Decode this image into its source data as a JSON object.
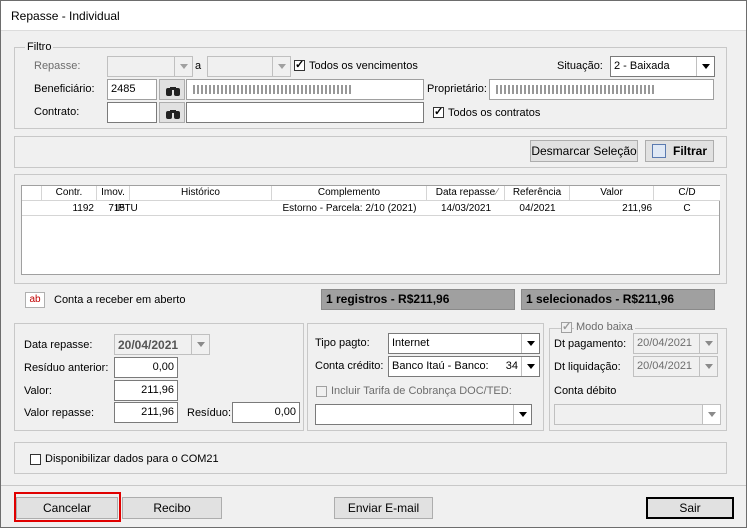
{
  "window": {
    "title": "Repasse - Individual"
  },
  "filtro": {
    "legend": "Filtro",
    "repasse_label": "Repasse:",
    "repasse_from": "",
    "a_label": "a",
    "repasse_to": "",
    "todos_vencimentos": {
      "label": "Todos os vencimentos",
      "checked": true
    },
    "situacao_label": "Situação:",
    "situacao_value": "2 - Baixada",
    "beneficiario_label": "Beneficiário:",
    "beneficiario_code": "2485",
    "proprietario_label": "Proprietário:",
    "contrato_label": "Contrato:",
    "contrato_code": "",
    "contrato_name": "",
    "todos_contratos": {
      "label": "Todos os contratos",
      "checked": true
    }
  },
  "toolbar": {
    "desmarcar_label": "Desmarcar Seleção",
    "filtrar_label": "Filtrar"
  },
  "grid": {
    "columns": [
      "Contr.",
      "Imov.",
      "Histórico",
      "Complemento",
      "Data repasse",
      "Referência",
      "Valor",
      "C/D"
    ],
    "rows": [
      {
        "contr": "1192",
        "imov": "715",
        "historico": "IPTU",
        "complemento": "Estorno - Parcela: 2/10 (2021)",
        "data_repasse": "14/03/2021",
        "referencia": "04/2021",
        "valor": "211,96",
        "cd": "C"
      }
    ]
  },
  "legend_bar": {
    "icon_text": "ab",
    "label": "Conta a receber em aberto",
    "registros": "1 registros - R$211,96",
    "selecionados": "1 selecionados - R$211,96"
  },
  "values": {
    "data_repasse_label": "Data repasse:",
    "data_repasse": "20/04/2021",
    "residuo_anterior_label": "Resíduo anterior:",
    "residuo_anterior": "0,00",
    "valor_label": "Valor:",
    "valor": "211,96",
    "valor_repasse_label": "Valor repasse:",
    "valor_repasse": "211,96",
    "residuo_label": "Resíduo:",
    "residuo": "0,00"
  },
  "pagamento": {
    "tipo_pagto_label": "Tipo pagto:",
    "tipo_pagto": "Internet",
    "conta_credito_label": "Conta crédito:",
    "conta_credito": "Banco Itaú - Banco:",
    "conta_credito_num": "34",
    "incluir_tarifa_label": "Incluir Tarifa de Cobrança DOC/TED:",
    "incluir_tarifa_value": ""
  },
  "baixa": {
    "modo_baixa_label": "Modo baixa",
    "dt_pagamento_label": "Dt pagamento:",
    "dt_pagamento": "20/04/2021",
    "dt_liquidacao_label": "Dt liquidação:",
    "dt_liquidacao": "20/04/2021",
    "conta_debito_label": "Conta débito"
  },
  "options": {
    "disponibilizar_label": "Disponibilizar dados para o COM21"
  },
  "footer": {
    "cancelar_label": "Cancelar",
    "recibo_label": "Recibo",
    "enviar_email_label": "Enviar E-mail",
    "sair_label": "Sair"
  },
  "colors": {
    "highlight": "#e00000",
    "summary_bg": "#a0a0a0",
    "icon_red": "#c00000"
  },
  "icons": {
    "search": "binoculars-icon",
    "filter": "filter-icon",
    "ab": "conta-aberto-icon"
  }
}
